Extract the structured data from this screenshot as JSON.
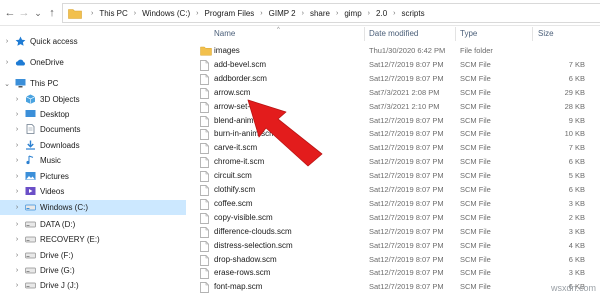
{
  "nav_buttons": {
    "back_icon": "←",
    "forward_icon": "→",
    "recent_icon": "⌄",
    "up_icon": "↑"
  },
  "breadcrumbs": [
    "This PC",
    "Windows (C:)",
    "Program Files",
    "GIMP 2",
    "share",
    "gimp",
    "2.0",
    "scripts"
  ],
  "columns": {
    "name": "Name",
    "date": "Date modified",
    "type": "Type",
    "size": "Size"
  },
  "navpane": [
    {
      "label": "Quick access",
      "icon": "star-icon",
      "color": "#1e7bd4",
      "chev": "›"
    },
    {
      "label": "OneDrive",
      "icon": "cloud-icon",
      "color": "#1e7bd4",
      "chev": "›"
    },
    {
      "label": "This PC",
      "icon": "computer-icon",
      "color": "#3b8fd9",
      "chev": "⌄"
    },
    {
      "label": "3D Objects",
      "icon": "cube-icon",
      "color": "#4aa3e0",
      "chev": "›"
    },
    {
      "label": "Desktop",
      "icon": "desktop-icon",
      "color": "#3b8fd9",
      "chev": "›"
    },
    {
      "label": "Documents",
      "icon": "documents-icon",
      "color": "#6b7b8c",
      "chev": "›"
    },
    {
      "label": "Downloads",
      "icon": "download-icon",
      "color": "#2a7fd0",
      "chev": "›"
    },
    {
      "label": "Music",
      "icon": "music-icon",
      "color": "#2a7fd0",
      "chev": "›"
    },
    {
      "label": "Pictures",
      "icon": "pictures-icon",
      "color": "#3b8fd9",
      "chev": "›"
    },
    {
      "label": "Videos",
      "icon": "videos-icon",
      "color": "#6b4fc7",
      "chev": "›"
    },
    {
      "label": "Windows (C:)",
      "icon": "drive-icon",
      "color": "#3b8fd9",
      "chev": "›"
    },
    {
      "label": "DATA (D:)",
      "icon": "drive-icon",
      "color": "#8c8c8c",
      "chev": "›"
    },
    {
      "label": "RECOVERY (E:)",
      "icon": "drive-icon",
      "color": "#8c8c8c",
      "chev": "›"
    },
    {
      "label": "Drive (F:)",
      "icon": "drive-icon",
      "color": "#8c8c8c",
      "chev": "›"
    },
    {
      "label": "Drive (G:)",
      "icon": "drive-icon",
      "color": "#8c8c8c",
      "chev": "›"
    },
    {
      "label": "Drive J (J:)",
      "icon": "drive-icon",
      "color": "#8c8c8c",
      "chev": "›"
    }
  ],
  "selected_nav": "Windows (C:)",
  "files": [
    {
      "name": "images",
      "date": "Thu1/30/2020 6:42 PM",
      "type": "File folder",
      "size": "",
      "kind": "folder"
    },
    {
      "name": "add-bevel.scm",
      "date": "Sat12/7/2019 8:07 PM",
      "type": "SCM File",
      "size": "7 KB",
      "kind": "file"
    },
    {
      "name": "addborder.scm",
      "date": "Sat12/7/2019 8:07 PM",
      "type": "SCM File",
      "size": "6 KB",
      "kind": "file"
    },
    {
      "name": "arrow.scm",
      "date": "Sat7/3/2021 2:08 PM",
      "type": "SCM File",
      "size": "29 KB",
      "kind": "file"
    },
    {
      "name": "arrow-set-",
      "date": "Sat7/3/2021 2:10 PM",
      "type": "SCM File",
      "size": "28 KB",
      "kind": "file"
    },
    {
      "name": "blend-anim",
      "date": "Sat12/7/2019 8:07 PM",
      "type": "SCM File",
      "size": "9 KB",
      "kind": "file"
    },
    {
      "name": "burn-in-anim.scm",
      "date": "Sat12/7/2019 8:07 PM",
      "type": "SCM File",
      "size": "10 KB",
      "kind": "file"
    },
    {
      "name": "carve-it.scm",
      "date": "Sat12/7/2019 8:07 PM",
      "type": "SCM File",
      "size": "7 KB",
      "kind": "file"
    },
    {
      "name": "chrome-it.scm",
      "date": "Sat12/7/2019 8:07 PM",
      "type": "SCM File",
      "size": "6 KB",
      "kind": "file"
    },
    {
      "name": "circuit.scm",
      "date": "Sat12/7/2019 8:07 PM",
      "type": "SCM File",
      "size": "5 KB",
      "kind": "file"
    },
    {
      "name": "clothify.scm",
      "date": "Sat12/7/2019 8:07 PM",
      "type": "SCM File",
      "size": "6 KB",
      "kind": "file"
    },
    {
      "name": "coffee.scm",
      "date": "Sat12/7/2019 8:07 PM",
      "type": "SCM File",
      "size": "3 KB",
      "kind": "file"
    },
    {
      "name": "copy-visible.scm",
      "date": "Sat12/7/2019 8:07 PM",
      "type": "SCM File",
      "size": "2 KB",
      "kind": "file"
    },
    {
      "name": "difference-clouds.scm",
      "date": "Sat12/7/2019 8:07 PM",
      "type": "SCM File",
      "size": "3 KB",
      "kind": "file"
    },
    {
      "name": "distress-selection.scm",
      "date": "Sat12/7/2019 8:07 PM",
      "type": "SCM File",
      "size": "4 KB",
      "kind": "file"
    },
    {
      "name": "drop-shadow.scm",
      "date": "Sat12/7/2019 8:07 PM",
      "type": "SCM File",
      "size": "6 KB",
      "kind": "file"
    },
    {
      "name": "erase-rows.scm",
      "date": "Sat12/7/2019 8:07 PM",
      "type": "SCM File",
      "size": "3 KB",
      "kind": "file"
    },
    {
      "name": "font-map.scm",
      "date": "Sat12/7/2019 8:07 PM",
      "type": "SCM File",
      "size": "6 KB",
      "kind": "file"
    }
  ],
  "watermark": "wsxdn.com",
  "colors": {
    "accent": "#0078d7",
    "selection": "#cce8ff",
    "folder": "#f2c04d",
    "arrow": "#e31c1c"
  }
}
